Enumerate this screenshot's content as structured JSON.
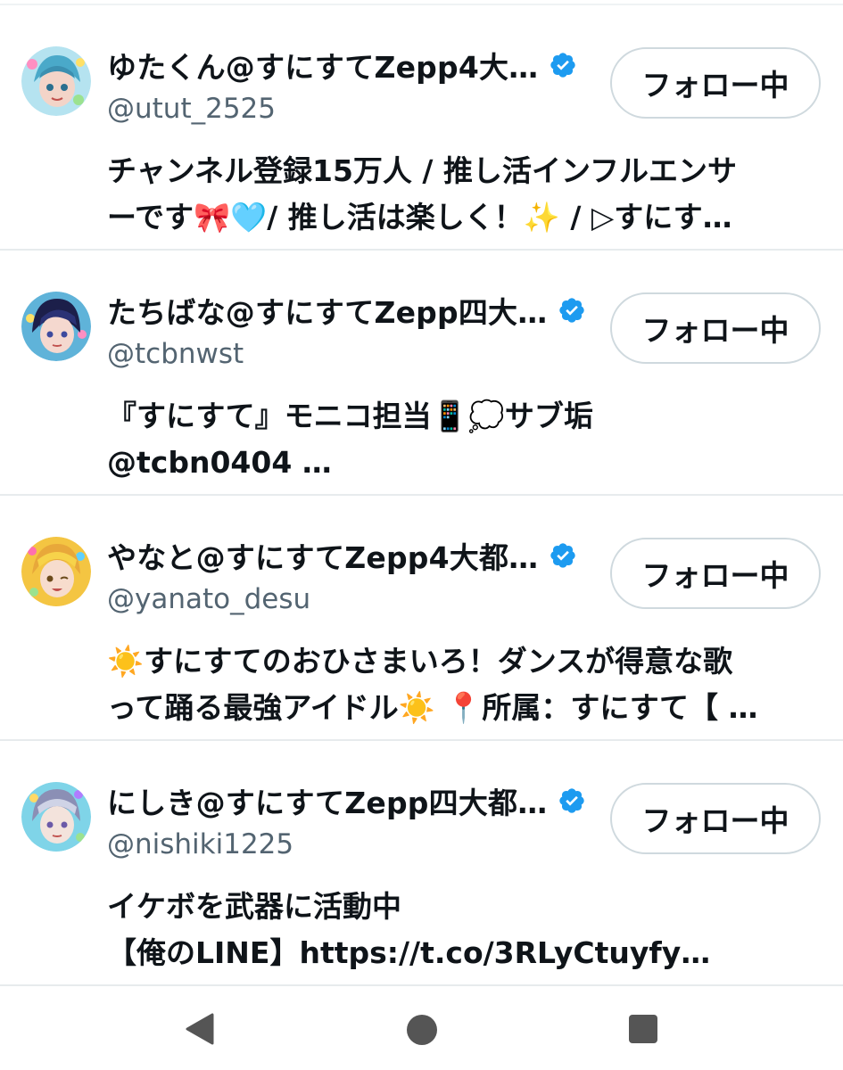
{
  "users": [
    {
      "name": "ゆたくん@すにすてZepp4大…",
      "handle": "@utut_2525",
      "button_label": "フォロー中",
      "bio_lines": [
        "チャンネル登録15万人 / 推し活インフルエンサ",
        "ーです🎀🩵/ 推し活は楽しく！✨ / ▷すにす…"
      ],
      "avatar_colors": [
        "#b5e3f0",
        "#4aa9c9",
        "#f3d4c8"
      ]
    },
    {
      "name": "たちばな@すにすてZepp四大…",
      "handle": "@tcbnwst",
      "button_label": "フォロー中",
      "bio_lines": [
        "『すにすて』モニコ担当📱💭サブ垢",
        "@tcbn0404 …"
      ],
      "avatar_colors": [
        "#3d4a9e",
        "#1c1f4a",
        "#f5d8cf"
      ]
    },
    {
      "name": "やなと@すにすてZepp4大都…",
      "handle": "@yanato_desu",
      "button_label": "フォロー中",
      "bio_lines": [
        "☀️すにすてのおひさまいろ！ダンスが得意な歌",
        "って踊る最強アイドル☀️ 📍所属：すにすて【 …"
      ],
      "avatar_colors": [
        "#f7d34a",
        "#e8a83a",
        "#f7dccd"
      ]
    },
    {
      "name": "にしき@すにすてZepp四大都…",
      "handle": "@nishiki1225",
      "button_label": "フォロー中",
      "bio_lines": [
        "イケボを武器に活動中",
        "【俺のLINE】https://t.co/3RLyCtuyfy…"
      ],
      "avatar_colors": [
        "#cfd3e6",
        "#8b8fb5",
        "#f3e3dc"
      ]
    }
  ],
  "colors": {
    "verified": "#1d9bf0",
    "text_primary": "#0f1419",
    "text_secondary": "#536471",
    "divider": "#e7ebed"
  },
  "nav": {
    "back_icon": "triangle-back",
    "home_icon": "circle-home",
    "recents_icon": "square-recents"
  }
}
